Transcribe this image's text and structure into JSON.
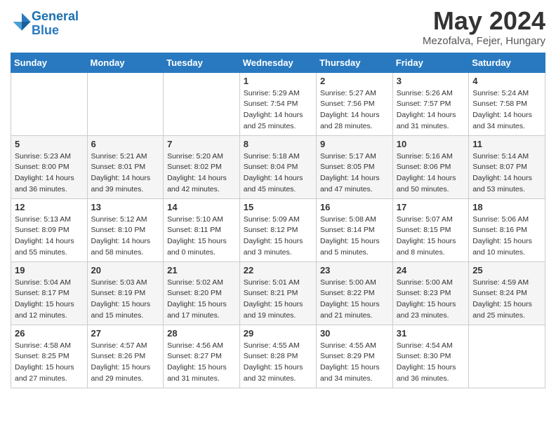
{
  "header": {
    "logo_general": "General",
    "logo_blue": "Blue",
    "month_title": "May 2024",
    "location": "Mezofalva, Fejer, Hungary"
  },
  "weekdays": [
    "Sunday",
    "Monday",
    "Tuesday",
    "Wednesday",
    "Thursday",
    "Friday",
    "Saturday"
  ],
  "weeks": [
    [
      {
        "day": "",
        "sunrise": "",
        "sunset": "",
        "daylight": ""
      },
      {
        "day": "",
        "sunrise": "",
        "sunset": "",
        "daylight": ""
      },
      {
        "day": "",
        "sunrise": "",
        "sunset": "",
        "daylight": ""
      },
      {
        "day": "1",
        "sunrise": "Sunrise: 5:29 AM",
        "sunset": "Sunset: 7:54 PM",
        "daylight": "Daylight: 14 hours and 25 minutes."
      },
      {
        "day": "2",
        "sunrise": "Sunrise: 5:27 AM",
        "sunset": "Sunset: 7:56 PM",
        "daylight": "Daylight: 14 hours and 28 minutes."
      },
      {
        "day": "3",
        "sunrise": "Sunrise: 5:26 AM",
        "sunset": "Sunset: 7:57 PM",
        "daylight": "Daylight: 14 hours and 31 minutes."
      },
      {
        "day": "4",
        "sunrise": "Sunrise: 5:24 AM",
        "sunset": "Sunset: 7:58 PM",
        "daylight": "Daylight: 14 hours and 34 minutes."
      }
    ],
    [
      {
        "day": "5",
        "sunrise": "Sunrise: 5:23 AM",
        "sunset": "Sunset: 8:00 PM",
        "daylight": "Daylight: 14 hours and 36 minutes."
      },
      {
        "day": "6",
        "sunrise": "Sunrise: 5:21 AM",
        "sunset": "Sunset: 8:01 PM",
        "daylight": "Daylight: 14 hours and 39 minutes."
      },
      {
        "day": "7",
        "sunrise": "Sunrise: 5:20 AM",
        "sunset": "Sunset: 8:02 PM",
        "daylight": "Daylight: 14 hours and 42 minutes."
      },
      {
        "day": "8",
        "sunrise": "Sunrise: 5:18 AM",
        "sunset": "Sunset: 8:04 PM",
        "daylight": "Daylight: 14 hours and 45 minutes."
      },
      {
        "day": "9",
        "sunrise": "Sunrise: 5:17 AM",
        "sunset": "Sunset: 8:05 PM",
        "daylight": "Daylight: 14 hours and 47 minutes."
      },
      {
        "day": "10",
        "sunrise": "Sunrise: 5:16 AM",
        "sunset": "Sunset: 8:06 PM",
        "daylight": "Daylight: 14 hours and 50 minutes."
      },
      {
        "day": "11",
        "sunrise": "Sunrise: 5:14 AM",
        "sunset": "Sunset: 8:07 PM",
        "daylight": "Daylight: 14 hours and 53 minutes."
      }
    ],
    [
      {
        "day": "12",
        "sunrise": "Sunrise: 5:13 AM",
        "sunset": "Sunset: 8:09 PM",
        "daylight": "Daylight: 14 hours and 55 minutes."
      },
      {
        "day": "13",
        "sunrise": "Sunrise: 5:12 AM",
        "sunset": "Sunset: 8:10 PM",
        "daylight": "Daylight: 14 hours and 58 minutes."
      },
      {
        "day": "14",
        "sunrise": "Sunrise: 5:10 AM",
        "sunset": "Sunset: 8:11 PM",
        "daylight": "Daylight: 15 hours and 0 minutes."
      },
      {
        "day": "15",
        "sunrise": "Sunrise: 5:09 AM",
        "sunset": "Sunset: 8:12 PM",
        "daylight": "Daylight: 15 hours and 3 minutes."
      },
      {
        "day": "16",
        "sunrise": "Sunrise: 5:08 AM",
        "sunset": "Sunset: 8:14 PM",
        "daylight": "Daylight: 15 hours and 5 minutes."
      },
      {
        "day": "17",
        "sunrise": "Sunrise: 5:07 AM",
        "sunset": "Sunset: 8:15 PM",
        "daylight": "Daylight: 15 hours and 8 minutes."
      },
      {
        "day": "18",
        "sunrise": "Sunrise: 5:06 AM",
        "sunset": "Sunset: 8:16 PM",
        "daylight": "Daylight: 15 hours and 10 minutes."
      }
    ],
    [
      {
        "day": "19",
        "sunrise": "Sunrise: 5:04 AM",
        "sunset": "Sunset: 8:17 PM",
        "daylight": "Daylight: 15 hours and 12 minutes."
      },
      {
        "day": "20",
        "sunrise": "Sunrise: 5:03 AM",
        "sunset": "Sunset: 8:19 PM",
        "daylight": "Daylight: 15 hours and 15 minutes."
      },
      {
        "day": "21",
        "sunrise": "Sunrise: 5:02 AM",
        "sunset": "Sunset: 8:20 PM",
        "daylight": "Daylight: 15 hours and 17 minutes."
      },
      {
        "day": "22",
        "sunrise": "Sunrise: 5:01 AM",
        "sunset": "Sunset: 8:21 PM",
        "daylight": "Daylight: 15 hours and 19 minutes."
      },
      {
        "day": "23",
        "sunrise": "Sunrise: 5:00 AM",
        "sunset": "Sunset: 8:22 PM",
        "daylight": "Daylight: 15 hours and 21 minutes."
      },
      {
        "day": "24",
        "sunrise": "Sunrise: 5:00 AM",
        "sunset": "Sunset: 8:23 PM",
        "daylight": "Daylight: 15 hours and 23 minutes."
      },
      {
        "day": "25",
        "sunrise": "Sunrise: 4:59 AM",
        "sunset": "Sunset: 8:24 PM",
        "daylight": "Daylight: 15 hours and 25 minutes."
      }
    ],
    [
      {
        "day": "26",
        "sunrise": "Sunrise: 4:58 AM",
        "sunset": "Sunset: 8:25 PM",
        "daylight": "Daylight: 15 hours and 27 minutes."
      },
      {
        "day": "27",
        "sunrise": "Sunrise: 4:57 AM",
        "sunset": "Sunset: 8:26 PM",
        "daylight": "Daylight: 15 hours and 29 minutes."
      },
      {
        "day": "28",
        "sunrise": "Sunrise: 4:56 AM",
        "sunset": "Sunset: 8:27 PM",
        "daylight": "Daylight: 15 hours and 31 minutes."
      },
      {
        "day": "29",
        "sunrise": "Sunrise: 4:55 AM",
        "sunset": "Sunset: 8:28 PM",
        "daylight": "Daylight: 15 hours and 32 minutes."
      },
      {
        "day": "30",
        "sunrise": "Sunrise: 4:55 AM",
        "sunset": "Sunset: 8:29 PM",
        "daylight": "Daylight: 15 hours and 34 minutes."
      },
      {
        "day": "31",
        "sunrise": "Sunrise: 4:54 AM",
        "sunset": "Sunset: 8:30 PM",
        "daylight": "Daylight: 15 hours and 36 minutes."
      },
      {
        "day": "",
        "sunrise": "",
        "sunset": "",
        "daylight": ""
      }
    ]
  ]
}
